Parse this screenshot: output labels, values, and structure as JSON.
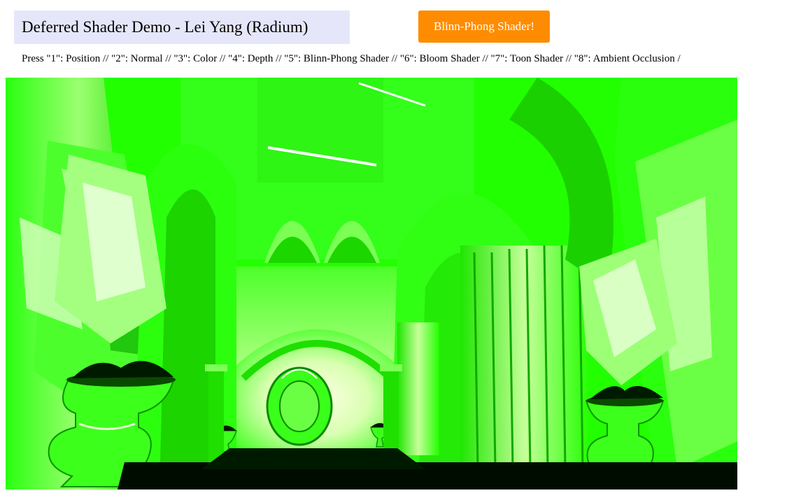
{
  "header": {
    "title": "Deferred Shader Demo - Lei Yang (Radium)",
    "shader_button_label": "Blinn-Phong Shader!"
  },
  "instructions": "Press \"1\": Position // \"2\": Normal // \"3\": Color // \"4\": Depth // \"5\": Blinn-Phong Shader // \"6\": Bloom Shader // \"7\": Toon Shader // \"8\": Ambient Occlusion /",
  "colors": {
    "button": "#ff8c00",
    "title_bg": "#e6e6fa",
    "scene_green": "#22ff00"
  }
}
